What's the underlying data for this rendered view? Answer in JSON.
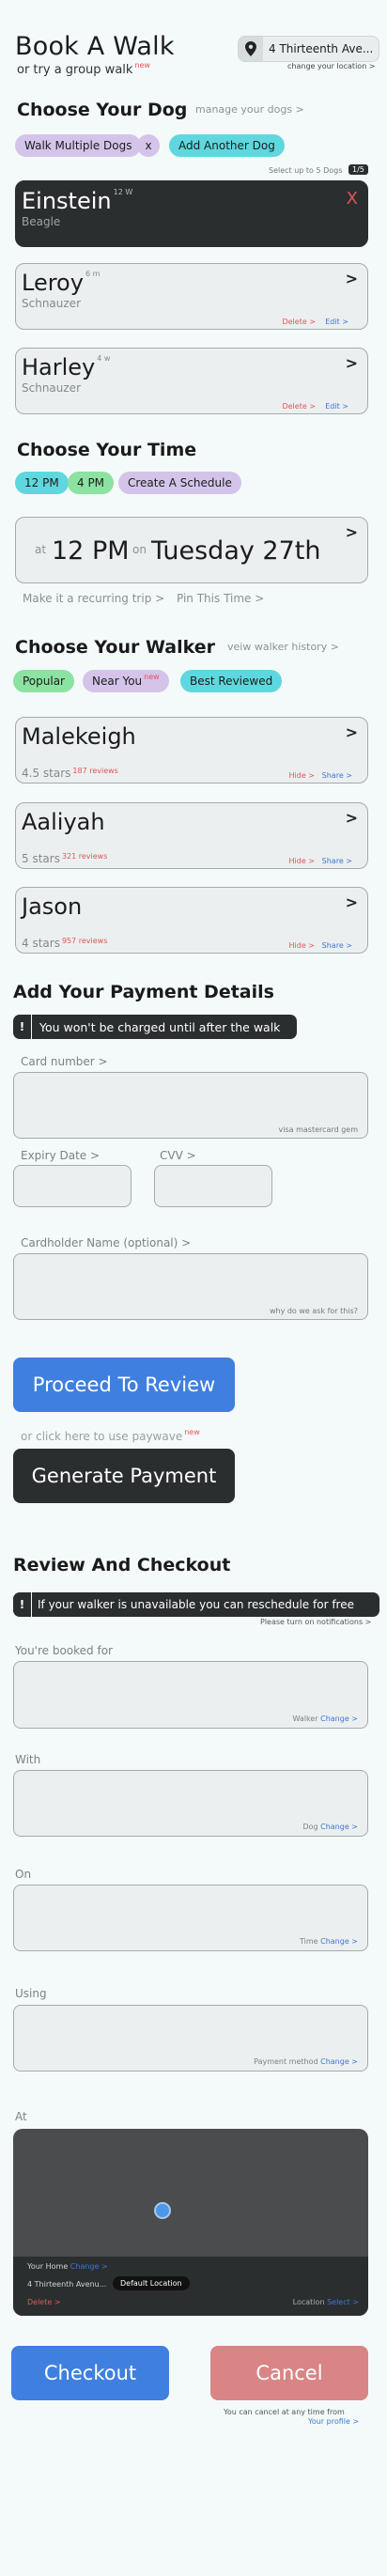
{
  "header": {
    "title": "Book A Walk",
    "subtitle": "or try a group walk",
    "subtitle_tag": "new",
    "location": "4 Thirteenth Ave...",
    "change_location": "change your location >"
  },
  "dogs": {
    "title": "Choose Your Dog",
    "manage_link": "manage your dogs >",
    "chip_multiple": "Walk Multiple Dogs",
    "chip_x": "x",
    "chip_add": "Add Another Dog",
    "select_hint": "Select up to 5 Dogs",
    "select_count": "1/5",
    "items": [
      {
        "name": "Einstein",
        "age": "12 W",
        "breed": "Beagle",
        "close": "X"
      },
      {
        "name": "Leroy",
        "age": "6 m",
        "breed": "Schnauzer",
        "delete": "Delete >",
        "edit": "Edit >"
      },
      {
        "name": "Harley",
        "age": "4 w",
        "breed": "Schnauzer",
        "delete": "Delete >",
        "edit": "Edit >"
      }
    ]
  },
  "time": {
    "title": "Choose Your Time",
    "chips": [
      "12 PM",
      "4 PM",
      "Create A Schedule"
    ],
    "at_label": "at",
    "at_value": "12 PM",
    "on_label": "on",
    "on_value": "Tuesday 27th",
    "recurring": "Make it a recurring trip >",
    "pin": "Pin This Time >"
  },
  "walker": {
    "title": "Choose Your Walker",
    "history_link": "veiw walker history >",
    "chips": [
      "Popular",
      "Near You",
      "Best Reviewed"
    ],
    "near_tag": "new",
    "items": [
      {
        "name": "Malekeigh",
        "stars": "4.5 stars",
        "reviews": "187 reviews",
        "hide": "Hide >",
        "share": "Share >"
      },
      {
        "name": "Aaliyah",
        "stars": "5 stars",
        "reviews": "321 reviews",
        "hide": "Hide >",
        "share": "Share >"
      },
      {
        "name": "Jason",
        "stars": "4 stars",
        "reviews": "957 reviews",
        "hide": "Hide >",
        "share": "Share >"
      }
    ]
  },
  "payment": {
    "title": "Add Your Payment Details",
    "banner": "You won't be charged until after the walk",
    "bang": "!",
    "card_label": "Card number >",
    "card_hint": "visa mastercard gem",
    "expiry_label": "Expiry Date >",
    "cvv_label": "CVV >",
    "name_label": "Cardholder Name (optional) >",
    "name_hint": "why do we ask for this?",
    "proceed": "Proceed To Review",
    "paywave_text": "or click here to use paywave",
    "paywave_tag": "new",
    "generate": "Generate Payment"
  },
  "review": {
    "title": "Review And Checkout",
    "banner": "If your walker is unavailable you can reschedule for free",
    "bang": "!",
    "notify": "Please turn on notifications >",
    "booked_label": "You're booked for",
    "walker_hint": "Walker",
    "with_label": "With",
    "dog_hint": "Dog",
    "on_label": "On",
    "time_hint": "Time",
    "using_label": "Using",
    "method_hint": "Payment method",
    "change": "Change >",
    "at_label": "At",
    "home_label": "Your Home",
    "home_change": "Change >",
    "home_address": "4 Thirteenth Avenu...",
    "default_badge": "Default Location",
    "delete": "Delete >",
    "location_label": "Location",
    "select": "Select >"
  },
  "footer": {
    "checkout": "Checkout",
    "cancel": "Cancel",
    "cancel_note": "You can cancel at any time from",
    "profile_link": "Your profile >"
  },
  "colors": {
    "accent_blue": "#3f7fe0",
    "dark": "#2b2e2f",
    "danger": "#e0555a",
    "cancel": "#d98585",
    "chip_purple": "#d4c4ea",
    "chip_cyan": "#5ed8de",
    "chip_green": "#8ce2a0"
  }
}
